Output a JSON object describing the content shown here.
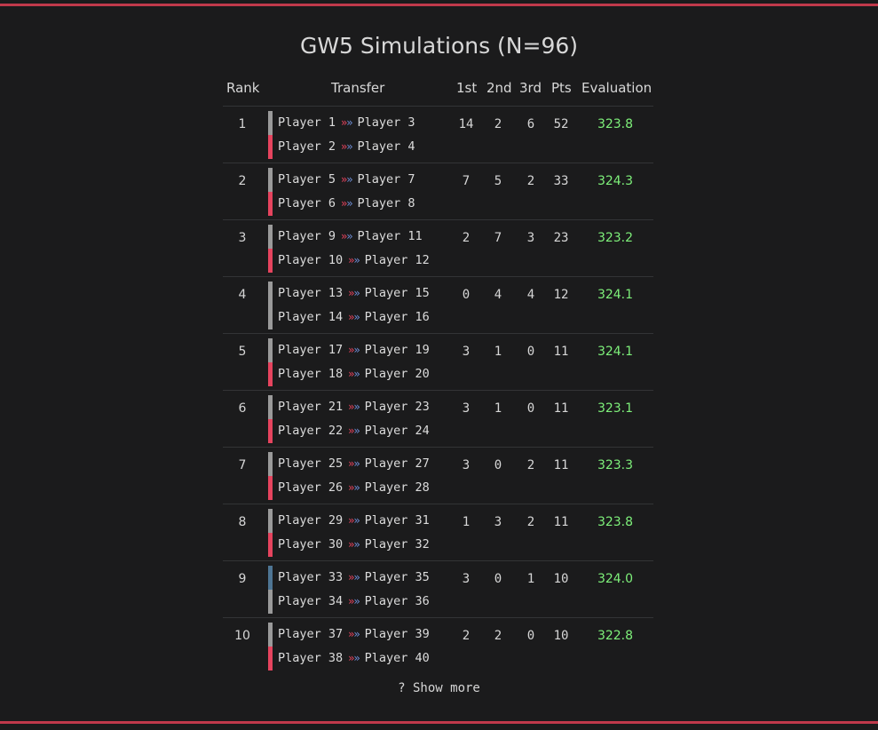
{
  "title": "GW5 Simulations (N=96)",
  "headers": {
    "rank": "Rank",
    "transfer": "Transfer",
    "first": "1st",
    "second": "2nd",
    "third": "3rd",
    "pts": "Pts",
    "evaluation": "Evaluation"
  },
  "arrow_glyph": "»»",
  "rows": [
    {
      "rank": "1",
      "transfers": [
        {
          "out": "Player 1",
          "in": "Player 3",
          "bar": "gray"
        },
        {
          "out": "Player 2",
          "in": "Player 4",
          "bar": "red"
        }
      ],
      "first": "14",
      "second": "2",
      "third": "6",
      "pts": "52",
      "evaluation": "323.8"
    },
    {
      "rank": "2",
      "transfers": [
        {
          "out": "Player 5",
          "in": "Player 7",
          "bar": "gray"
        },
        {
          "out": "Player 6",
          "in": "Player 8",
          "bar": "red"
        }
      ],
      "first": "7",
      "second": "5",
      "third": "2",
      "pts": "33",
      "evaluation": "324.3"
    },
    {
      "rank": "3",
      "transfers": [
        {
          "out": "Player 9",
          "in": "Player 11",
          "bar": "gray"
        },
        {
          "out": "Player 10",
          "in": "Player 12",
          "bar": "red"
        }
      ],
      "first": "2",
      "second": "7",
      "third": "3",
      "pts": "23",
      "evaluation": "323.2"
    },
    {
      "rank": "4",
      "transfers": [
        {
          "out": "Player 13",
          "in": "Player 15",
          "bar": "gray"
        },
        {
          "out": "Player 14",
          "in": "Player 16",
          "bar": "gray"
        }
      ],
      "first": "0",
      "second": "4",
      "third": "4",
      "pts": "12",
      "evaluation": "324.1"
    },
    {
      "rank": "5",
      "transfers": [
        {
          "out": "Player 17",
          "in": "Player 19",
          "bar": "gray"
        },
        {
          "out": "Player 18",
          "in": "Player 20",
          "bar": "red"
        }
      ],
      "first": "3",
      "second": "1",
      "third": "0",
      "pts": "11",
      "evaluation": "324.1"
    },
    {
      "rank": "6",
      "transfers": [
        {
          "out": "Player 21",
          "in": "Player 23",
          "bar": "gray"
        },
        {
          "out": "Player 22",
          "in": "Player 24",
          "bar": "red"
        }
      ],
      "first": "3",
      "second": "1",
      "third": "0",
      "pts": "11",
      "evaluation": "323.1"
    },
    {
      "rank": "7",
      "transfers": [
        {
          "out": "Player 25",
          "in": "Player 27",
          "bar": "gray"
        },
        {
          "out": "Player 26",
          "in": "Player 28",
          "bar": "red"
        }
      ],
      "first": "3",
      "second": "0",
      "third": "2",
      "pts": "11",
      "evaluation": "323.3"
    },
    {
      "rank": "8",
      "transfers": [
        {
          "out": "Player 29",
          "in": "Player 31",
          "bar": "gray"
        },
        {
          "out": "Player 30",
          "in": "Player 32",
          "bar": "red"
        }
      ],
      "first": "1",
      "second": "3",
      "third": "2",
      "pts": "11",
      "evaluation": "323.8"
    },
    {
      "rank": "9",
      "transfers": [
        {
          "out": "Player 33",
          "in": "Player 35",
          "bar": "blue"
        },
        {
          "out": "Player 34",
          "in": "Player 36",
          "bar": "gray"
        }
      ],
      "first": "3",
      "second": "0",
      "third": "1",
      "pts": "10",
      "evaluation": "324.0"
    },
    {
      "rank": "10",
      "transfers": [
        {
          "out": "Player 37",
          "in": "Player 39",
          "bar": "gray"
        },
        {
          "out": "Player 38",
          "in": "Player 40",
          "bar": "red"
        }
      ],
      "first": "2",
      "second": "2",
      "third": "0",
      "pts": "10",
      "evaluation": "322.8"
    }
  ],
  "show_more": "? Show more",
  "colors": {
    "background": "#1b1b1c",
    "border_accent": "#c0394b",
    "evaluation": "#7ef07a",
    "bar_gray": "#9a9a9a",
    "bar_red": "#e6445e",
    "bar_blue": "#4e7594",
    "arrow_red": "#e6445e",
    "arrow_blue": "#6f8fd8"
  }
}
